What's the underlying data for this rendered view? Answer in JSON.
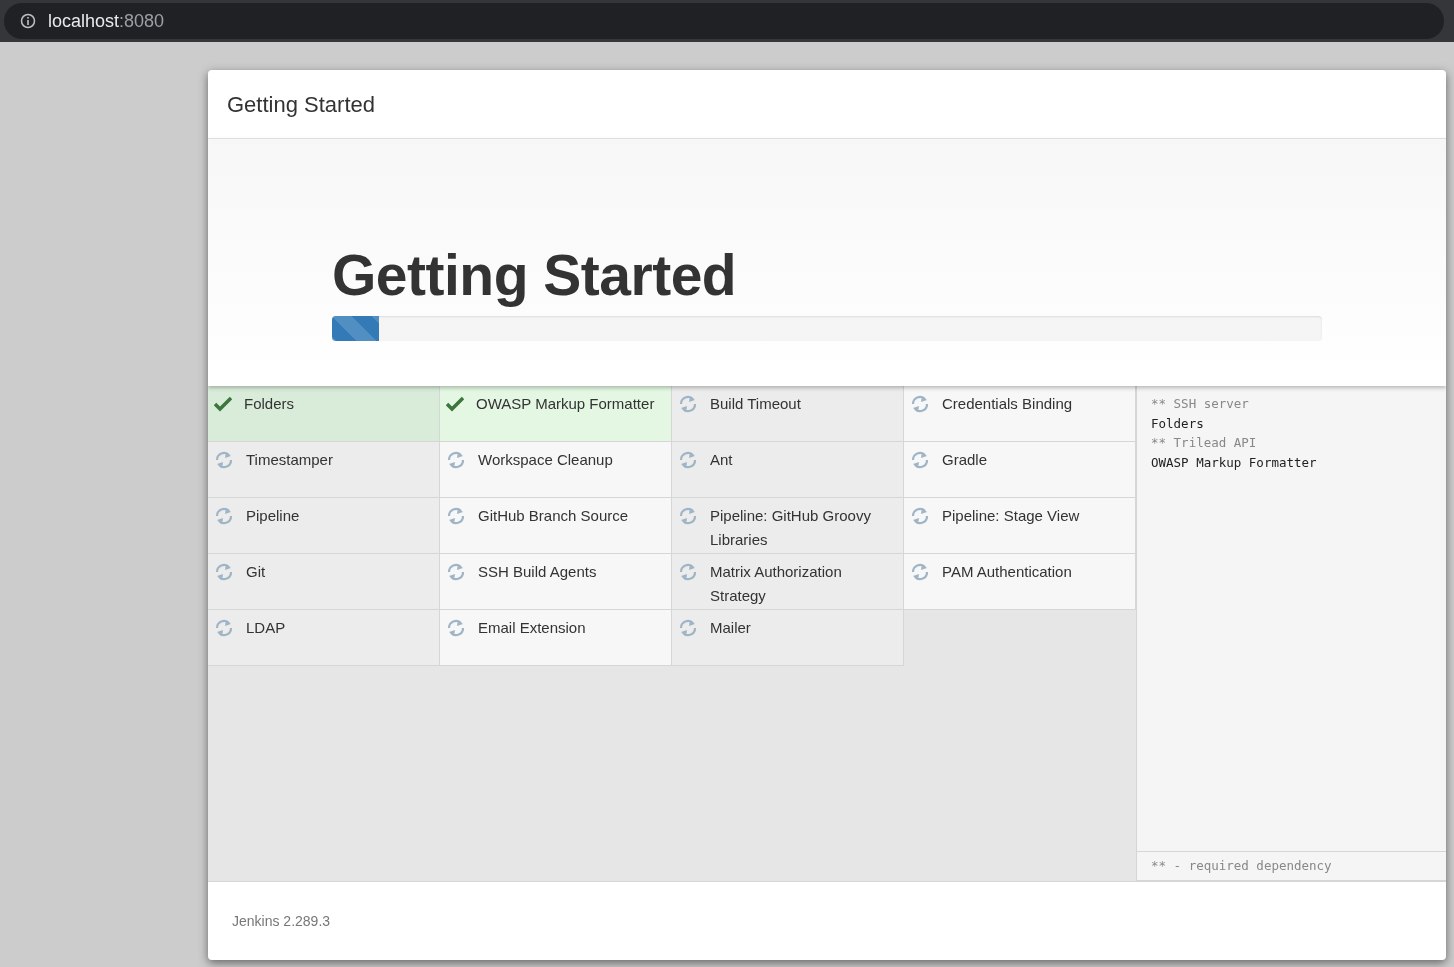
{
  "browser": {
    "host": "localhost",
    "port": ":8080"
  },
  "dialog": {
    "title": "Getting Started"
  },
  "hero": {
    "heading": "Getting Started",
    "progress": {
      "level": 0.047
    }
  },
  "plugins": [
    {
      "name": "Folders",
      "kind": "installed"
    },
    {
      "name": "OWASP Markup Formatter",
      "kind": "installed"
    },
    {
      "name": "Build Timeout",
      "kind": "pending"
    },
    {
      "name": "Credentials Binding",
      "kind": "pending"
    },
    {
      "name": "Timestamper",
      "kind": "pending"
    },
    {
      "name": "Workspace Cleanup",
      "kind": "pending"
    },
    {
      "name": "Ant",
      "kind": "pending"
    },
    {
      "name": "Gradle",
      "kind": "pending"
    },
    {
      "name": "Pipeline",
      "kind": "pending"
    },
    {
      "name": "GitHub Branch Source",
      "kind": "pending"
    },
    {
      "name": "Pipeline: GitHub Groovy Libraries",
      "kind": "pending"
    },
    {
      "name": "Pipeline: Stage View",
      "kind": "pending"
    },
    {
      "name": "Git",
      "kind": "pending"
    },
    {
      "name": "SSH Build Agents",
      "kind": "pending"
    },
    {
      "name": "Matrix Authorization Strategy",
      "kind": "pending"
    },
    {
      "name": "PAM Authentication",
      "kind": "pending"
    },
    {
      "name": "LDAP",
      "kind": "pending"
    },
    {
      "name": "Email Extension",
      "kind": "pending"
    },
    {
      "name": "Mailer",
      "kind": "pending"
    }
  ],
  "log": [
    {
      "text": "** SSH server",
      "kind": "dependency"
    },
    {
      "text": "Folders",
      "kind": "plugin"
    },
    {
      "text": "** Trilead API",
      "kind": "dependency"
    },
    {
      "text": "OWASP Markup Formatter",
      "kind": "plugin"
    }
  ],
  "legend": "** - required dependency",
  "footer": {
    "version": "Jenkins 2.289.3"
  }
}
